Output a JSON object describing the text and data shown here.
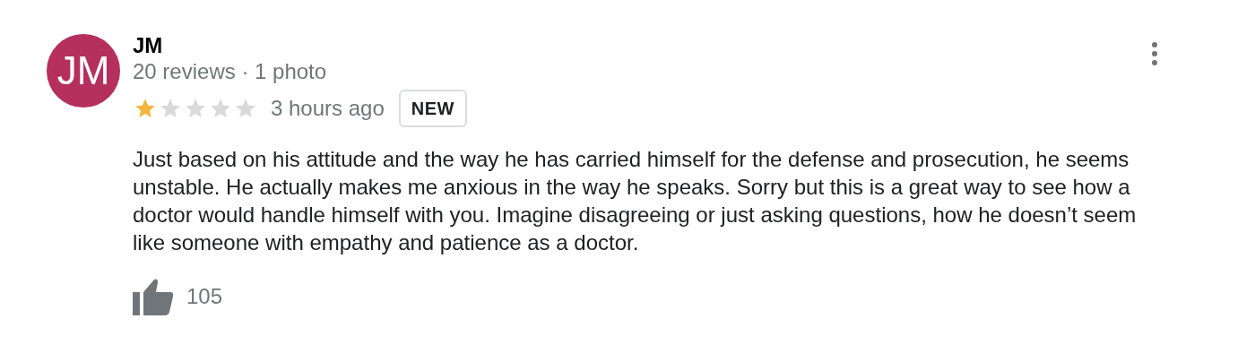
{
  "review": {
    "avatar_initials": "JM",
    "name": "JM",
    "meta": "20 reviews · 1 photo",
    "stars": 1,
    "time": "3 hours ago",
    "badge": "NEW",
    "text": "Just based on his attitude and the way he has carried himself for the defense and prosecution, he seems unstable. He actually makes me anxious in the way he speaks. Sorry but this is a great way to see how a doctor would handle himself with you. Imagine disagreeing or just asking questions, how he doesn’t seem like someone with empathy and patience as a doctor.",
    "likes": "105"
  }
}
